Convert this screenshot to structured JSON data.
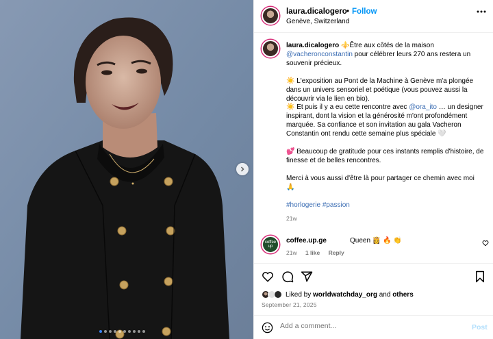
{
  "header": {
    "username": "laura.dicalogero",
    "separator": "•",
    "follow_label": "Follow",
    "location": "Genève, Switzerland",
    "more_icon": "more-horizontal-icon"
  },
  "media": {
    "next_icon": "chevron-right-icon",
    "carousel_count": 10,
    "carousel_active": 0
  },
  "caption": {
    "username": "laura.dicalogero",
    "line1_text": " ⚜️Être aux côtés de la maison ",
    "mention1": "@vacheronconstantin",
    "line1_rest": " pour célébrer leurs 270 ans restera un souvenir précieux.",
    "para2": "☀️ L'exposition au Pont de la Machine à Genève m'a plongée dans un univers sensoriel et poétique (vous pouvez aussi la découvrir via le lien en bio).",
    "para3_a": "☀️ Et puis il y a eu cette rencontre avec ",
    "mention2": "@ora_ito",
    "para3_b": " … un designer inspirant, dont la vision et la générosité m'ont profondément marquée. Sa confiance et son invitation au gala Vacheron Constantin ont rendu cette semaine plus spéciale 🤍",
    "para4": "💕 Beaucoup de gratitude pour ces instants remplis d'histoire, de finesse et de belles rencontres.",
    "para5": "Merci à vous aussi d'être là pour partager ce chemin avec moi 🙏",
    "hashtags": "#horlogerie #passion",
    "time": "21w"
  },
  "comment": {
    "avatar_text": "coffee up",
    "username": "coffee.up.ge",
    "text": " Queen 👸 🔥 👏",
    "time": "21w",
    "likes": "1 like",
    "reply": "Reply"
  },
  "actions": {
    "like_icon": "heart-icon",
    "comment_icon": "comment-icon",
    "share_icon": "share-icon",
    "save_icon": "bookmark-icon"
  },
  "likes": {
    "prefix": "Liked by ",
    "user": "worldwatchday_org",
    "middle": " and ",
    "others": "others"
  },
  "date": "September 21, 2025",
  "add_comment": {
    "placeholder": "Add a comment...",
    "post_label": "Post",
    "emoji_icon": "emoji-icon"
  },
  "colors": {
    "link": "#0095f6",
    "post_disabled": "#b2dffc",
    "carousel_active": "#3b82f6"
  }
}
